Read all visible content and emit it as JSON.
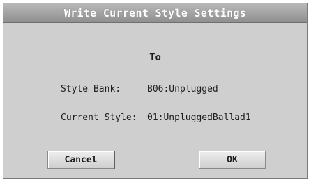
{
  "dialog": {
    "title": "Write Current Style Settings",
    "heading": "To",
    "rows": [
      {
        "label": "Style Bank:",
        "value": "B06:Unplugged"
      },
      {
        "label": "Current Style:",
        "value": "01:UnpluggedBallad1"
      }
    ],
    "buttons": {
      "cancel": "Cancel",
      "ok": "OK"
    }
  }
}
